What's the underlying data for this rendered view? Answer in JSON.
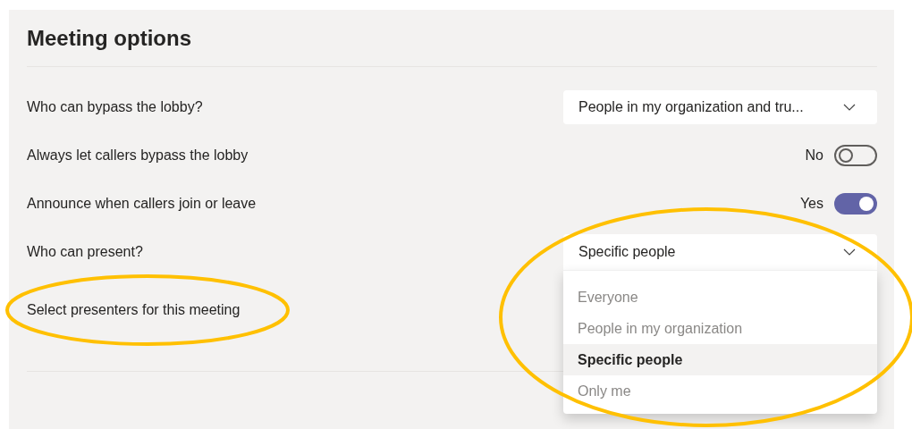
{
  "title": "Meeting options",
  "settings": [
    {
      "kind": "select",
      "label": "Who can bypass the lobby?",
      "value": "People in my organization and tru..."
    },
    {
      "kind": "toggle",
      "label": "Always let callers bypass the lobby",
      "state_text": "No",
      "on": false
    },
    {
      "kind": "toggle",
      "label": "Announce when callers join or leave",
      "state_text": "Yes",
      "on": true
    },
    {
      "kind": "open_select",
      "label": "Who can present?",
      "value": "Specific people",
      "options": [
        {
          "label": "Everyone",
          "selected": false
        },
        {
          "label": "People in my organization",
          "selected": false
        },
        {
          "label": "Specific people",
          "selected": true
        },
        {
          "label": "Only me",
          "selected": false
        }
      ]
    },
    {
      "kind": "label",
      "label": "Select presenters for this meeting"
    }
  ]
}
